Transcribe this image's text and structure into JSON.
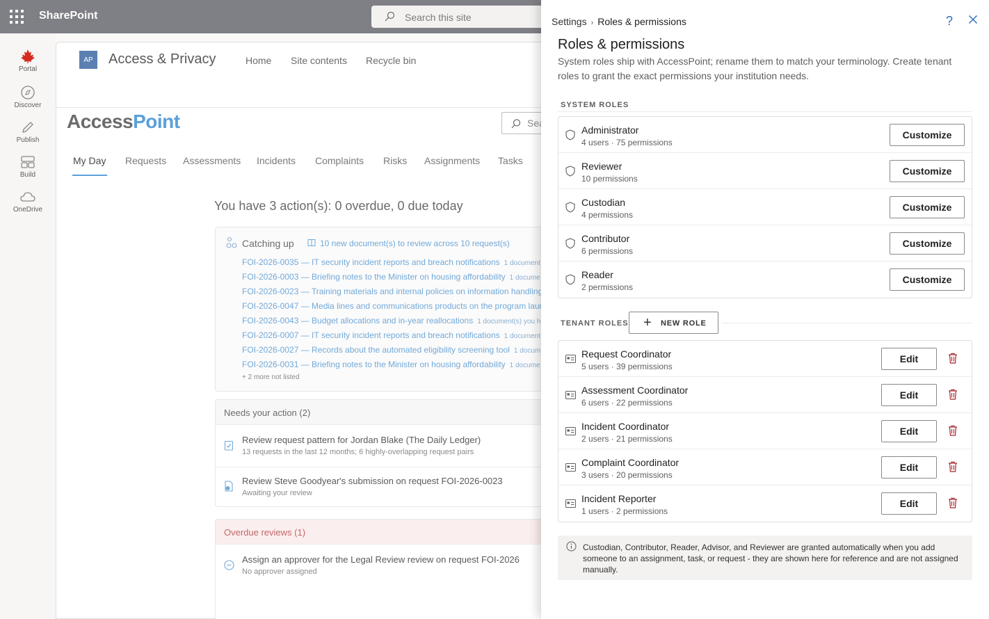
{
  "topbar": {
    "app_name": "SharePoint",
    "search_placeholder": "Search this site"
  },
  "rail": {
    "items": [
      {
        "label": "Portal",
        "icon": "maple-leaf-icon"
      },
      {
        "label": "Discover",
        "icon": "compass-icon"
      },
      {
        "label": "Publish",
        "icon": "pen-icon"
      },
      {
        "label": "Build",
        "icon": "layout-icon"
      },
      {
        "label": "OneDrive",
        "icon": "cloud-icon"
      }
    ]
  },
  "site": {
    "logo_text": "AP",
    "title": "Access & Privacy",
    "nav": [
      "Home",
      "Site contents",
      "Recycle bin"
    ],
    "app_logo_a": "Access",
    "app_logo_b": "Point",
    "app_search_placeholder": "Sea",
    "tabs": [
      "My Day",
      "Requests",
      "Assessments",
      "Incidents",
      "Complaints",
      "Risks",
      "Assignments",
      "Tasks"
    ],
    "active_tab": "My Day",
    "day_heading": "You have 3 action(s): 0 overdue, 0 due today",
    "catching_up": {
      "title": "Catching up",
      "summary": "10 new document(s) to review across 10 request(s)",
      "requests": [
        {
          "text": "FOI-2026-0035 — IT security incident reports and breach notifications",
          "count": "1 document"
        },
        {
          "text": "FOI-2026-0003 — Briefing notes to the Minister on housing affordability",
          "count": "1 docume"
        },
        {
          "text": "FOI-2026-0023 — Training materials and internal policies on information handling",
          "count": ""
        },
        {
          "text": "FOI-2026-0047 — Media lines and communications products on the program laun",
          "count": ""
        },
        {
          "text": "FOI-2026-0043 — Budget allocations and in-year reallocations",
          "count": "1 document(s) you ha"
        },
        {
          "text": "FOI-2026-0007 — IT security incident reports and breach notifications",
          "count": "1 document"
        },
        {
          "text": "FOI-2026-0027 — Records about the automated eligibility screening tool",
          "count": "1 docum"
        },
        {
          "text": "FOI-2026-0031 — Briefing notes to the Minister on housing affordability",
          "count": "1 docume"
        }
      ],
      "more": "+ 2 more not listed"
    },
    "needs_action": {
      "header": "Needs your action (2)",
      "items": [
        {
          "title": "Review request pattern for Jordan Blake (The Daily Ledger)",
          "sub": "13 requests in the last 12 months; 6 highly-overlapping request pairs"
        },
        {
          "title": "Review Steve Goodyear's submission on request FOI-2026-0023",
          "sub": "Awaiting your review"
        }
      ]
    },
    "overdue": {
      "header": "Overdue reviews (1)",
      "items": [
        {
          "title": "Assign an approver for the Legal Review review on request FOI-2026",
          "sub": "No approver assigned"
        }
      ]
    }
  },
  "panel": {
    "breadcrumb_root": "Settings",
    "breadcrumb_current": "Roles & permissions",
    "title": "Roles & permissions",
    "description": "System roles ship with AccessPoint; rename them to match your terminology. Create tenant roles to grant the exact permissions your institution needs.",
    "system_label": "SYSTEM ROLES",
    "system_roles": [
      {
        "name": "Administrator",
        "meta": "4 users · 75 permissions",
        "action": "Customize"
      },
      {
        "name": "Reviewer",
        "meta": "10 permissions",
        "action": "Customize"
      },
      {
        "name": "Custodian",
        "meta": "4 permissions",
        "action": "Customize"
      },
      {
        "name": "Contributor",
        "meta": "6 permissions",
        "action": "Customize"
      },
      {
        "name": "Reader",
        "meta": "2 permissions",
        "action": "Customize"
      }
    ],
    "tenant_label": "TENANT ROLES",
    "new_role_label": "NEW ROLE",
    "tenant_roles": [
      {
        "name": "Request Coordinator",
        "meta": "5 users · 39 permissions",
        "action": "Edit"
      },
      {
        "name": "Assessment Coordinator",
        "meta": "6 users · 22 permissions",
        "action": "Edit"
      },
      {
        "name": "Incident Coordinator",
        "meta": "2 users · 21 permissions",
        "action": "Edit"
      },
      {
        "name": "Complaint Coordinator",
        "meta": "3 users · 20 permissions",
        "action": "Edit"
      },
      {
        "name": "Incident Reporter",
        "meta": "1 users · 2 permissions",
        "action": "Edit"
      }
    ],
    "info_note": "Custodian, Contributor, Reader, Advisor, and Reviewer are granted automatically when you add someone to an assignment, task, or request - they are shown here for reference and are not assigned manually."
  },
  "colors": {
    "accent": "#5ba0d9",
    "danger": "#a4262c",
    "topbar": "#7f7f86"
  }
}
